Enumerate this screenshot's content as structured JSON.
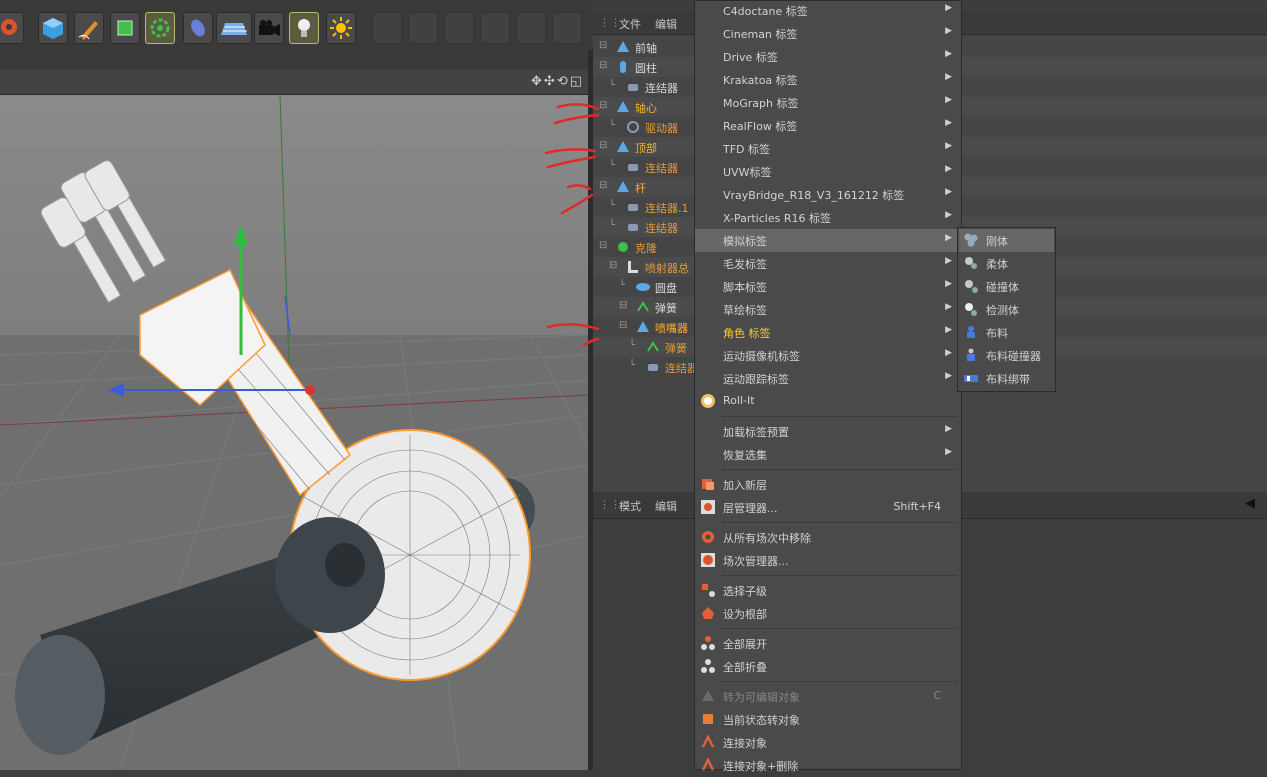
{
  "object_manager": {
    "menu": [
      "文件",
      "编辑"
    ],
    "tree": [
      {
        "label": "前轴",
        "color": "#d8d8d8",
        "indent": 0,
        "icon": "null-icon"
      },
      {
        "label": "圆柱",
        "color": "#d8d8d8",
        "indent": 0,
        "icon": "cylinder-icon"
      },
      {
        "label": "连结器",
        "color": "#d8d8d8",
        "indent": 1,
        "icon": "connector-tag-icon"
      },
      {
        "label": "轴心",
        "color": "#ffb030",
        "indent": 0,
        "icon": "null-icon"
      },
      {
        "label": "驱动器",
        "color": "#e59a3a",
        "indent": 1,
        "icon": "motor-icon"
      },
      {
        "label": "顶部",
        "color": "#ffb030",
        "indent": 0,
        "icon": "null-icon"
      },
      {
        "label": "连结器",
        "color": "#e59a3a",
        "indent": 1,
        "icon": "connector-tag-icon"
      },
      {
        "label": "杆",
        "color": "#ffb030",
        "indent": 0,
        "icon": "null-icon"
      },
      {
        "label": "连结器.1",
        "color": "#e59a3a",
        "indent": 1,
        "icon": "connector-tag-icon"
      },
      {
        "label": "连结器",
        "color": "#e59a3a",
        "indent": 1,
        "icon": "connector-tag-icon"
      },
      {
        "label": "克隆",
        "color": "#e59a3a",
        "indent": 0,
        "icon": "cloner-icon"
      },
      {
        "label": "喷射器总",
        "color": "#e59a3a",
        "indent": 1,
        "icon": "layer-null-icon"
      },
      {
        "label": "圆盘",
        "color": "#d8d8d8",
        "indent": 2,
        "icon": "disc-icon"
      },
      {
        "label": "弹簧",
        "color": "#d8d8d8",
        "indent": 2,
        "icon": "spring-icon"
      },
      {
        "label": "喷嘴器",
        "color": "#ffb030",
        "indent": 2,
        "icon": "null-icon"
      },
      {
        "label": "弹簧",
        "color": "#e59a3a",
        "indent": 3,
        "icon": "spring-icon"
      },
      {
        "label": "连结器",
        "color": "#e59a3a",
        "indent": 3,
        "icon": "connector-tag-icon"
      }
    ]
  },
  "attribute_manager": {
    "menu": [
      "模式",
      "编辑"
    ]
  },
  "context_menu": {
    "items": [
      {
        "label": "C4doctane 标签",
        "arrow": "▶"
      },
      {
        "label": "Cineman 标签",
        "arrow": "▶"
      },
      {
        "label": "Drive 标签",
        "arrow": "▶"
      },
      {
        "label": "Krakatoa 标签",
        "arrow": "▶"
      },
      {
        "label": "MoGraph 标签",
        "arrow": "▶"
      },
      {
        "label": "RealFlow 标签",
        "arrow": "▶"
      },
      {
        "label": "TFD 标签",
        "arrow": "▶"
      },
      {
        "label": "UVW标签",
        "arrow": "▶"
      },
      {
        "label": "VrayBridge_R18_V3_161212 标签",
        "arrow": "▶"
      },
      {
        "label": "X-Particles R16 标签",
        "arrow": "▶"
      },
      {
        "label": "模拟标签",
        "arrow": "▶",
        "highlight": true
      },
      {
        "label": "毛发标签",
        "arrow": "▶"
      },
      {
        "label": "脚本标签",
        "arrow": "▶"
      },
      {
        "label": "草绘标签",
        "arrow": "▶"
      },
      {
        "label": "角色 标签",
        "arrow": "▶",
        "color": "#ffcc33"
      },
      {
        "label": "运动摄像机标签",
        "arrow": "▶"
      },
      {
        "label": "运动跟踪标签",
        "arrow": "▶"
      },
      {
        "label": "Roll-It",
        "icon": "roll-it-icon"
      }
    ],
    "items2": [
      {
        "label": "加载标签预置",
        "arrow": "▶"
      },
      {
        "label": "恢复选集",
        "arrow": "▶"
      }
    ],
    "items3": [
      {
        "label": "加入新层",
        "icon": "add-layer-icon"
      },
      {
        "label": "层管理器...",
        "shortcut": "Shift+F4",
        "icon": "layer-manager-icon"
      }
    ],
    "items4": [
      {
        "label": "从所有场次中移除",
        "icon": "remove-take-icon"
      },
      {
        "label": "场次管理器...",
        "icon": "take-manager-icon"
      }
    ],
    "items5": [
      {
        "label": "选择子级",
        "icon": "select-children-icon"
      },
      {
        "label": "设为根部",
        "icon": "set-root-icon"
      }
    ],
    "items6": [
      {
        "label": "全部展开",
        "icon": "expand-all-icon"
      },
      {
        "label": "全部折叠",
        "icon": "collapse-all-icon"
      }
    ],
    "items7": [
      {
        "label": "转为可编辑对象",
        "shortcut": "C",
        "disabled": true,
        "icon": "make-editable-icon"
      },
      {
        "label": "当前状态转对象",
        "icon": "current-state-icon"
      },
      {
        "label": "连接对象",
        "icon": "connect-objects-icon"
      },
      {
        "label": "连接对象+删除",
        "icon": "connect-delete-icon"
      }
    ]
  },
  "submenu": {
    "items": [
      {
        "label": "刚体",
        "highlight": true,
        "icon": "rigid-body-icon"
      },
      {
        "label": "柔体",
        "icon": "soft-body-icon"
      },
      {
        "label": "碰撞体",
        "icon": "collider-body-icon"
      },
      {
        "label": "检测体",
        "icon": "ghost-body-icon"
      },
      {
        "label": "布料",
        "icon": "cloth-icon"
      },
      {
        "label": "布料碰撞器",
        "icon": "cloth-collider-icon"
      },
      {
        "label": "布料绑带",
        "icon": "cloth-belt-icon"
      }
    ]
  },
  "colors": {
    "accent": "#ffb030",
    "highlight": "#666666",
    "menu_bg": "#4a4a4a"
  }
}
